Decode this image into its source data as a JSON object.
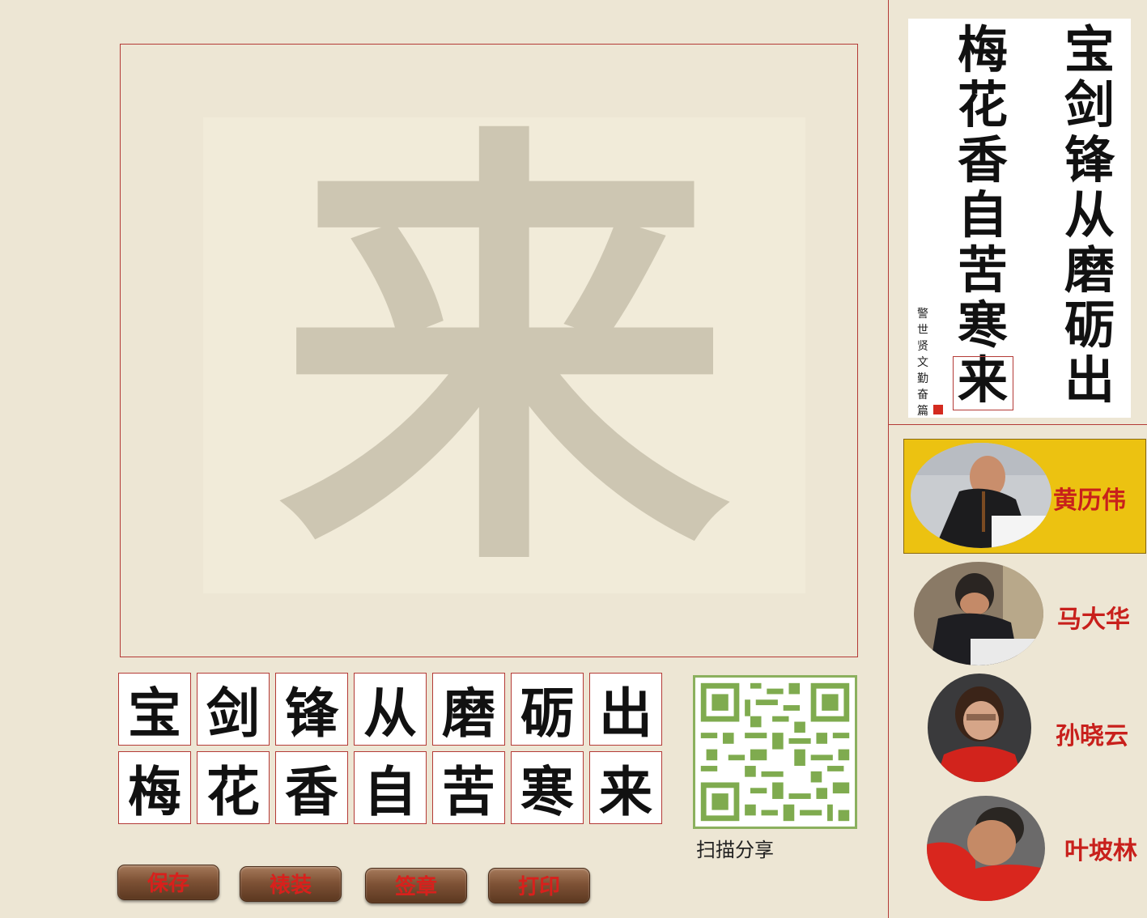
{
  "canvas": {
    "big_char": "来"
  },
  "characters": {
    "row1": [
      "宝",
      "剑",
      "锋",
      "从",
      "磨",
      "砺",
      "出"
    ],
    "row2": [
      "梅",
      "花",
      "香",
      "自",
      "苦",
      "寒",
      "来"
    ]
  },
  "qr": {
    "caption": "扫描分享"
  },
  "toolbar": {
    "save_label": "保存",
    "mount_label": "裱装",
    "seal_label": "签章",
    "print_label": "打印"
  },
  "scroll": {
    "right_col": [
      "宝",
      "剑",
      "锋",
      "从",
      "磨",
      "砺",
      "出"
    ],
    "left_col": [
      "梅",
      "花",
      "香",
      "自",
      "苦",
      "寒",
      "来"
    ],
    "inscription": [
      "警",
      "世",
      "贤",
      "文",
      "勤",
      "奋",
      "篇"
    ]
  },
  "artists": [
    {
      "name": "黄历伟",
      "selected": true
    },
    {
      "name": "马大华",
      "selected": false
    },
    {
      "name": "孙晓云",
      "selected": false
    },
    {
      "name": "叶坡林",
      "selected": false
    }
  ],
  "colors": {
    "background": "#ede6d4",
    "frame_border": "#b43a36",
    "button_text": "#d8201c",
    "artist_highlight": "#ecc211",
    "qr_green": "#8bb05e"
  }
}
